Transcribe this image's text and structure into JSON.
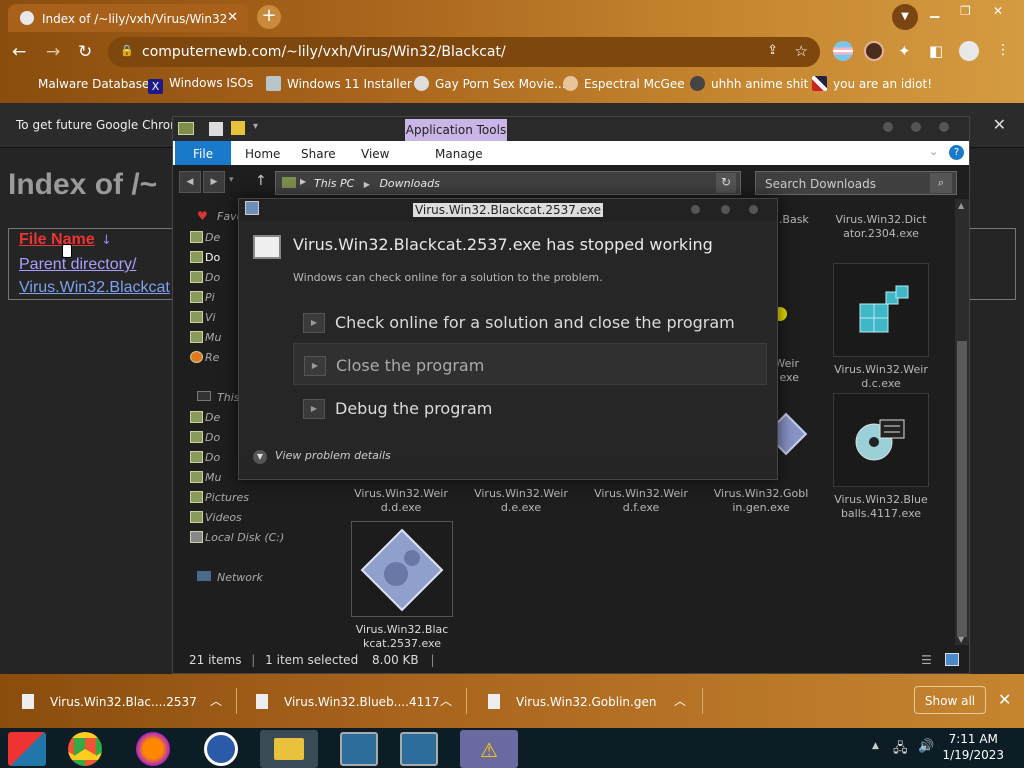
{
  "browser": {
    "tab_title": "Index of /~lily/vxh/Virus/Win32",
    "url": "computernewb.com/~lily/vxh/Virus/Win32/Blackcat/",
    "bookmarks": [
      "Malware Database",
      "Windows ISOs",
      "Windows 11 Installer",
      "Gay Porn Sex Movie...",
      "Espectral McGee",
      "uhhh anime shit",
      "you are an idiot!"
    ],
    "infobar_text": "To get future Google Chrom"
  },
  "page": {
    "title": "Index of /~",
    "column_header": "File Name",
    "sort_glyph": "↓",
    "parent_link": "Parent directory/",
    "file_link": "Virus.Win32.Blackcat"
  },
  "explorer": {
    "app_tools": "Application Tools",
    "ribbon_tabs": [
      "File",
      "Home",
      "Share",
      "View",
      "Manage"
    ],
    "path_root": "This PC",
    "path_current": "Downloads",
    "search_placeholder": "Search Downloads",
    "nav": {
      "favorites": "Favo",
      "fav_items": [
        "De",
        "Do",
        "Do",
        "Pi",
        "Vi",
        "Mu",
        "Re"
      ],
      "this_pc": "This",
      "pc_items": [
        "De",
        "Do",
        "Do",
        "Mu",
        "Pictures",
        "Videos",
        "Local Disk (C:)"
      ],
      "network": "Network"
    },
    "files_top": [
      "Virus.Win32.Bask",
      "Virus.Win32.Dict\nator.2304.exe"
    ],
    "files_mid": [
      "Virus.Win32.Weir\nd.c.exe"
    ],
    "files_row3": [
      "Virus.Win32.Weir\nd.d.exe",
      "Virus.Win32.Weir\nd.e.exe",
      "Virus.Win32.Weir\nd.f.exe",
      "Virus.Win32.Gobl\nin.gen.exe",
      "Virus.Win32.Blue\nballs.4117.exe"
    ],
    "files_row4": [
      "Virus.Win32.Blac\nkcat.2537.exe"
    ],
    "partial_labels": [
      "Weir",
      "exe"
    ],
    "status_count": "21 items",
    "status_selected": "1 item selected",
    "status_size": "8.00 KB"
  },
  "dialog": {
    "window_title": "Virus.Win32.Blackcat.2537.exe",
    "heading": "Virus.Win32.Blackcat.2537.exe has stopped working",
    "subtext": "Windows can check online for a solution to the problem.",
    "options": [
      "Check online for a solution and close the program",
      "Close the program",
      "Debug the program"
    ],
    "details_label": "View problem details"
  },
  "downloads": {
    "items": [
      "Virus.Win32.Blac....2537",
      "Virus.Win32.Blueb....4117",
      "Virus.Win32.Goblin.gen"
    ],
    "show_all": "Show all"
  },
  "taskbar": {
    "time": "7:11 AM",
    "date": "1/19/2023"
  },
  "colors": {
    "chrome_brown": "#a8641c",
    "accent_blue": "#1979ca",
    "app_tools_purple": "#c9b6e6",
    "link_red": "#ee3333",
    "link_purple": "#a8a0ff"
  }
}
